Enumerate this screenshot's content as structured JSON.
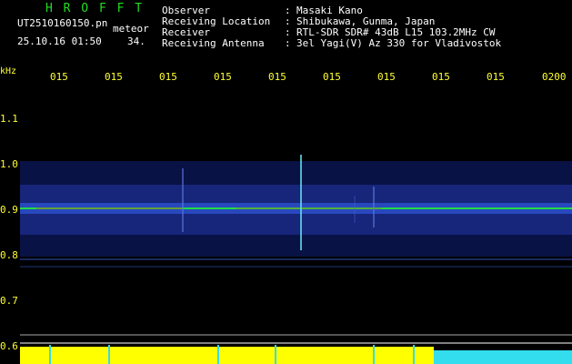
{
  "header": {
    "title": "H R O F F T",
    "file_name": "UT2510160150.pn",
    "meteor_label": "meteor",
    "date_time": "25.10.16 01:50",
    "count": "34.",
    "info": [
      {
        "label": "Observer",
        "value": "Masaki Kano"
      },
      {
        "label": "Receiving Location",
        "value": "Shibukawa, Gunma, Japan"
      },
      {
        "label": "Receiver",
        "value": "RTL-SDR SDR# 43dB L15 103.2MHz CW"
      },
      {
        "label": "Receiving Antenna",
        "value": "3el Yagi(V) Az 330 for Vladivostok"
      }
    ],
    "separator": ":"
  },
  "axes": {
    "khz_unit": "kHz",
    "time_ticks": [
      "015",
      "015",
      "015",
      "015",
      "015",
      "015",
      "015",
      "015",
      "015",
      "0200"
    ],
    "khz_ticks": [
      "1.1",
      "1.0",
      "0.9",
      "0.8",
      "0.7",
      "0.6"
    ]
  },
  "colors": {
    "background": "#000000",
    "title": "#22dd22",
    "text": "#ffffff",
    "tick_labels": "#ffff33",
    "noise_blue": "#2233aa",
    "signal_line": "#22dd44",
    "histogram": "#ffff00",
    "histogram_tail": "#33ddee"
  }
}
